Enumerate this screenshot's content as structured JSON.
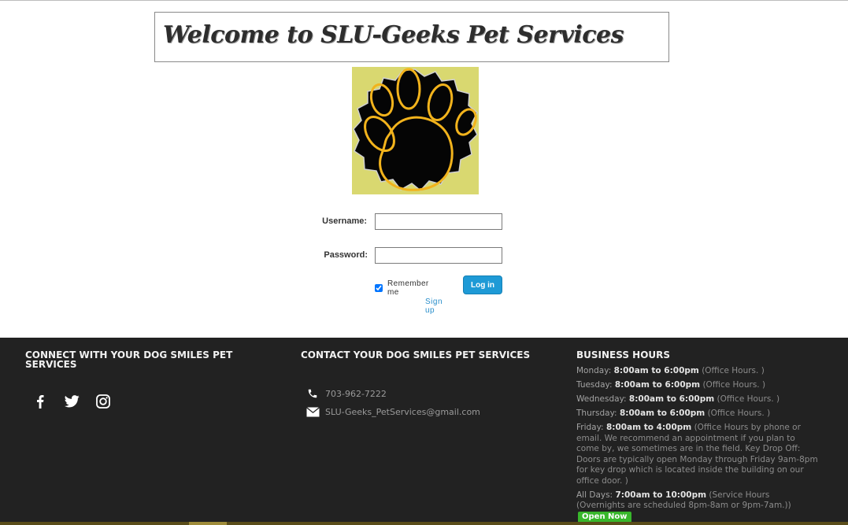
{
  "banner": {
    "title": "Welcome to SLU-Geeks Pet Services"
  },
  "login": {
    "username_label": "Username:",
    "username_value": "",
    "password_label": "Password:",
    "password_value": "",
    "remember_label": "Remember me",
    "remember_checked": true,
    "login_button": "Log in",
    "signup_link": "Sign up"
  },
  "footer": {
    "connect": {
      "title": "CONNECT WITH YOUR DOG SMILES PET SERVICES",
      "icons": [
        "facebook-icon",
        "twitter-icon",
        "instagram-icon"
      ]
    },
    "contact": {
      "title": "CONTACT YOUR DOG SMILES PET SERVICES",
      "phone": "703-962-7222",
      "email": "SLU-Geeks_PetServices@gmail.com"
    },
    "hours": {
      "title": "BUSINESS HOURS",
      "entries": [
        {
          "day": "Monday:",
          "time": "8:00am to 6:00pm",
          "note": "(Office Hours. )"
        },
        {
          "day": "Tuesday:",
          "time": "8:00am to 6:00pm",
          "note": "(Office Hours. )"
        },
        {
          "day": "Wednesday:",
          "time": "8:00am to 6:00pm",
          "note": "(Office Hours. )"
        },
        {
          "day": "Thursday:",
          "time": "8:00am to 6:00pm",
          "note": "(Office Hours. )"
        },
        {
          "day": "Friday:",
          "time": "8:00am to 4:00pm",
          "note": "(Office Hours by phone or email. We recommend an appointment if you plan to come by, we sometimes are in the field. Key Drop Off: Doors are typically open Monday through Friday 9am-8pm for key drop which is located inside the building on our office door. )"
        },
        {
          "day": "All Days:",
          "time": "7:00am to 10:00pm",
          "note": "(Service Hours (Overnights are scheduled 8pm-8am or 9pm-7am.))"
        }
      ],
      "open_now": "Open Now"
    }
  },
  "colors": {
    "footer_bg": "#222222",
    "login_button": "#1e9ad6",
    "open_now": "#38b72b",
    "logo_bg": "#d9d870",
    "paw_stroke": "#f2b31c"
  }
}
